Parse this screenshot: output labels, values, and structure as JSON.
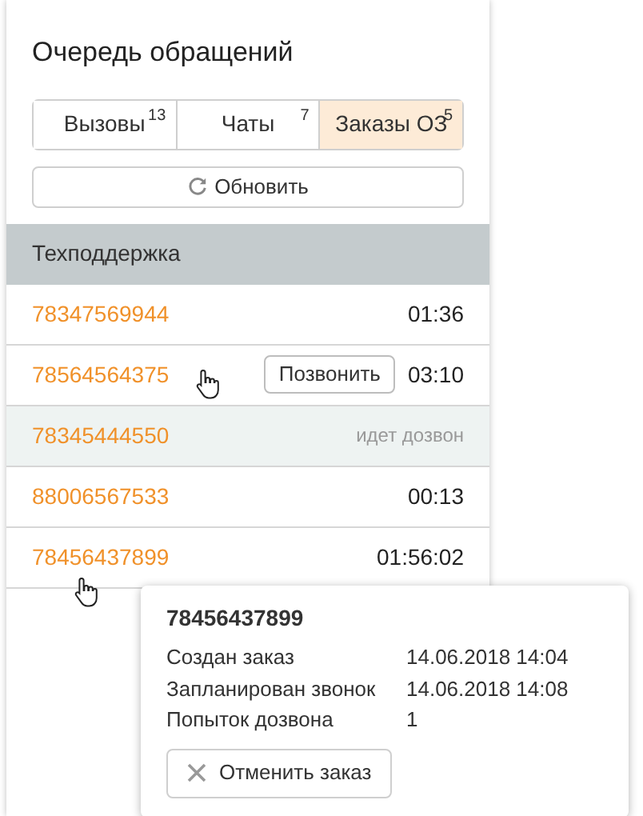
{
  "title": "Очередь обращений",
  "tabs": [
    {
      "label": "Вызовы",
      "count": "13",
      "selected": false
    },
    {
      "label": "Чаты",
      "count": "7",
      "selected": false
    },
    {
      "label": "Заказы ОЗ",
      "count": "5",
      "selected": true
    }
  ],
  "refresh_button": "Обновить",
  "section": "Техподдержка",
  "rows": [
    {
      "phone": "78347569944",
      "kind": "time",
      "time": "01:36",
      "highlighted": false
    },
    {
      "phone": "78564564375",
      "kind": "action",
      "button": "Позвонить",
      "time": "03:10",
      "highlighted": false
    },
    {
      "phone": "78345444550",
      "kind": "status",
      "status": "идет дозвон",
      "highlighted": true
    },
    {
      "phone": "88006567533",
      "kind": "time",
      "time": "00:13",
      "highlighted": false
    },
    {
      "phone": "78456437899",
      "kind": "time",
      "time": "01:56:02",
      "highlighted": false
    }
  ],
  "popup": {
    "phone": "78456437899",
    "details": [
      {
        "label": "Создан заказ",
        "value": "14.06.2018 14:04"
      },
      {
        "label": "Запланирован звонок",
        "value": "14.06.2018 14:08"
      },
      {
        "label": "Попыток дозвона",
        "value": "1"
      }
    ],
    "cancel_button": "Отменить заказ"
  }
}
